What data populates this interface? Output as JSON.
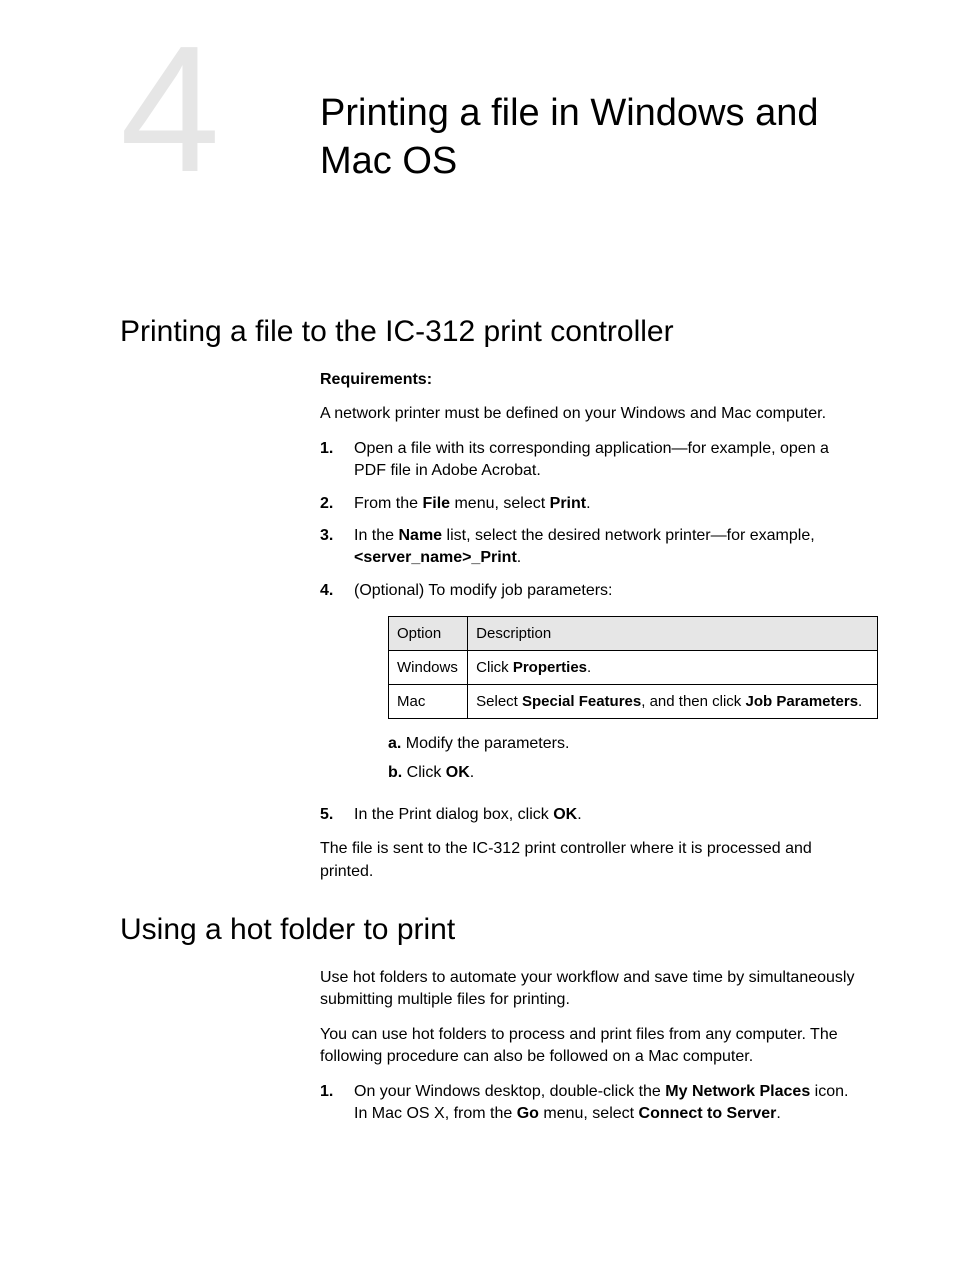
{
  "chapter": {
    "number": "4",
    "title": "Printing a file in Windows and Mac OS"
  },
  "section1": {
    "heading": "Printing a file to the IC-312 print controller",
    "requirements_label": "Requirements:",
    "requirements_text": "A network printer must be defined on your Windows and Mac computer.",
    "step1": {
      "num": "1.",
      "text": "Open a file with its corresponding application—for example, open a PDF file in Adobe Acrobat."
    },
    "step2": {
      "num": "2.",
      "pre": "From the ",
      "b1": "File",
      "mid": " menu, select ",
      "b2": "Print",
      "post": "."
    },
    "step3": {
      "num": "3.",
      "pre": "In the ",
      "b1": "Name",
      "mid": " list, select the desired network printer—for example, ",
      "b2": "<server_name>_Print",
      "post": "."
    },
    "step4": {
      "num": "4.",
      "text": "(Optional) To modify job parameters:",
      "table": {
        "h1": "Option",
        "h2": "Description",
        "r1c1": "Windows",
        "r1c2_pre": "Click ",
        "r1c2_b": "Properties",
        "r1c2_post": ".",
        "r2c1": "Mac",
        "r2c2_pre": "Select ",
        "r2c2_b1": "Special Features",
        "r2c2_mid": ", and then click ",
        "r2c2_b2": "Job Parameters",
        "r2c2_post": "."
      },
      "sub_a_letter": "a.",
      "sub_a_text": " Modify the parameters.",
      "sub_b_letter": "b.",
      "sub_b_pre": " Click ",
      "sub_b_b": "OK",
      "sub_b_post": "."
    },
    "step5": {
      "num": "5.",
      "pre": "In the Print dialog box, click ",
      "b1": "OK",
      "post": "."
    },
    "closing": "The file is sent to the IC-312 print controller where it is processed and printed."
  },
  "section2": {
    "heading": "Using a hot folder to print",
    "para1": "Use hot folders to automate your workflow and save time by simultaneously submitting multiple files for printing.",
    "para2": "You can use hot folders to process and print files from any computer. The following procedure can also be followed on a Mac computer.",
    "step1": {
      "num": "1.",
      "line1_pre": "On your Windows desktop, double-click the ",
      "line1_b": "My Network Places",
      "line1_post": " icon.",
      "line2_pre": "In Mac OS X, from the ",
      "line2_b1": "Go",
      "line2_mid": " menu, select ",
      "line2_b2": "Connect to Server",
      "line2_post": "."
    }
  }
}
